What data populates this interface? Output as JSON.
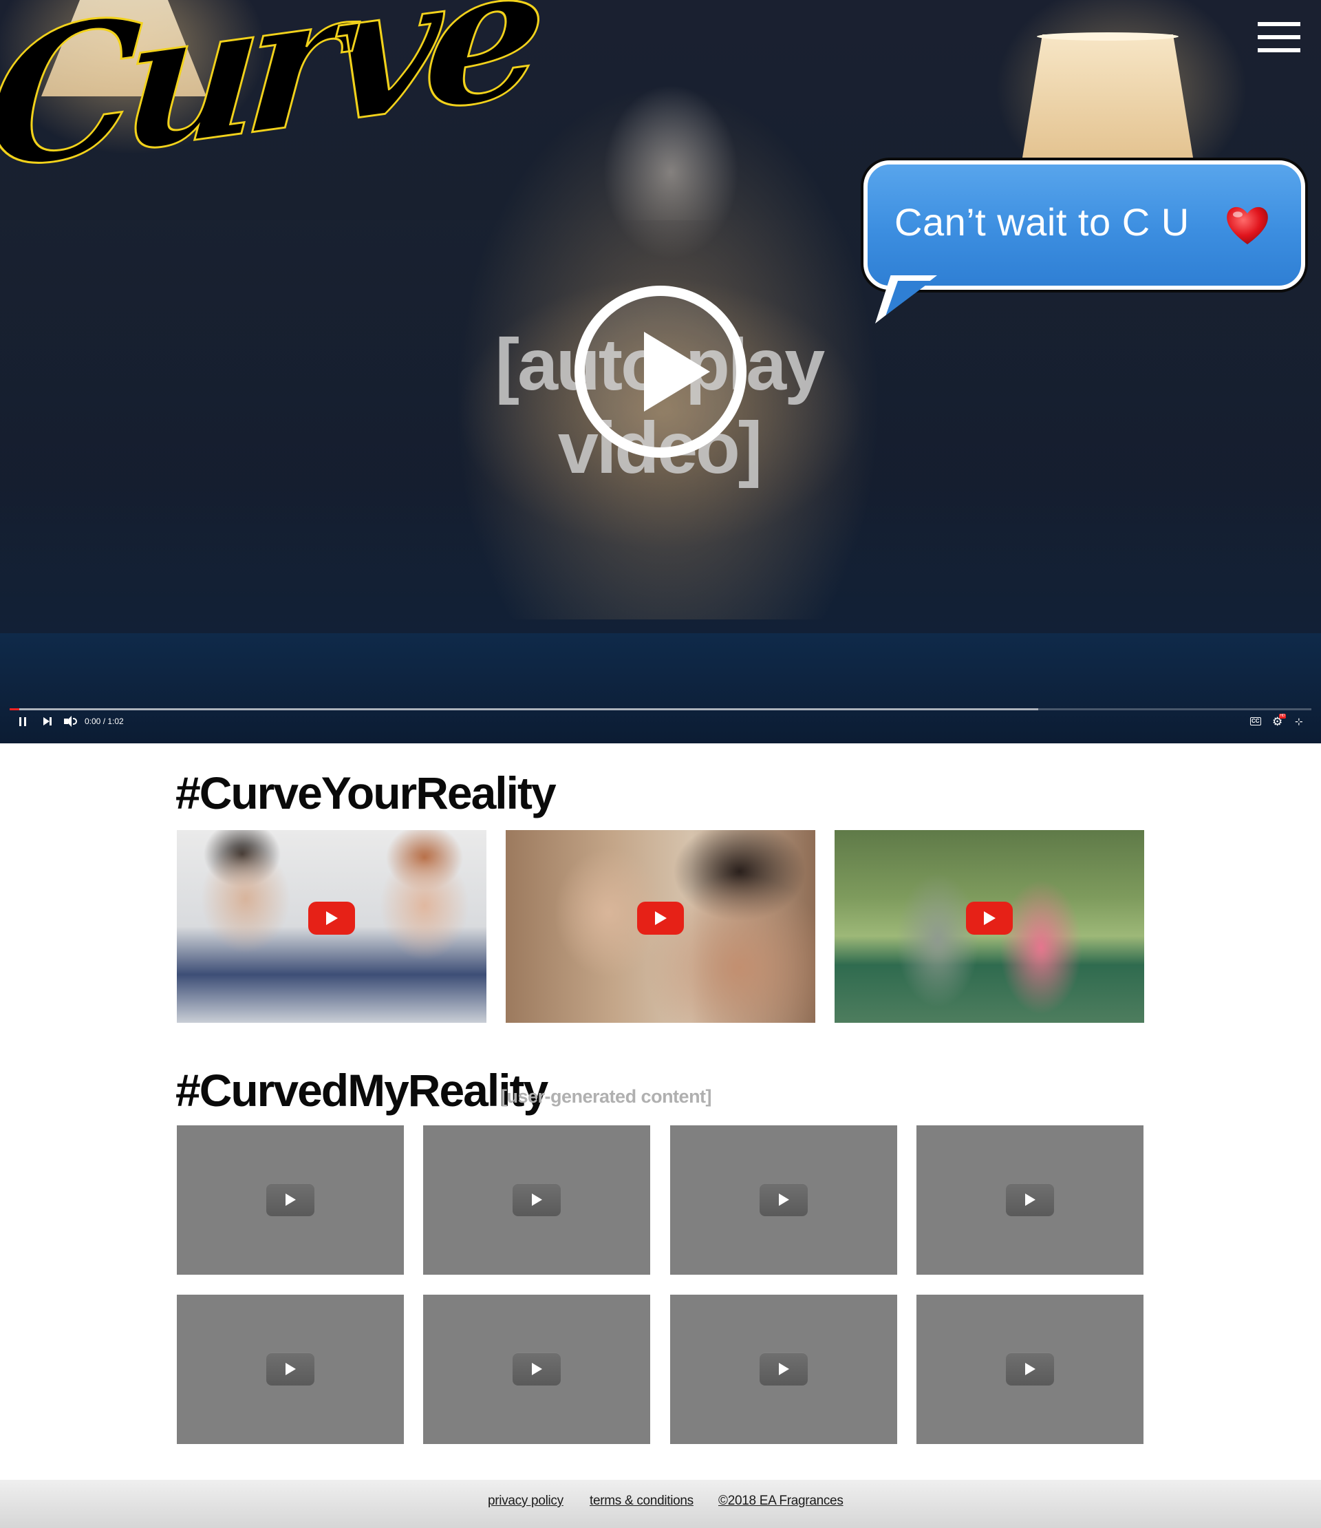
{
  "hero": {
    "logo_text": "Curve",
    "message_text": "Can’t wait to C U",
    "overlay_label": "[auto-play video]",
    "player": {
      "time_display": "0:00 / 1:02",
      "progress_fraction": 0.0,
      "buffered_fraction": 0.79
    },
    "icons": {
      "menu": "hamburger-menu-icon",
      "heart": "heart-icon",
      "play": "play-icon",
      "pause": "pause-icon",
      "next": "next-icon",
      "volume": "volume-icon",
      "captions": "cc-icon",
      "settings": "settings-icon",
      "fullscreen": "fullscreen-exit-icon"
    }
  },
  "curve_your_reality": {
    "title": "#CurveYourReality",
    "videos": [
      {
        "icon": "youtube-play-icon"
      },
      {
        "icon": "youtube-play-icon"
      },
      {
        "icon": "youtube-play-icon"
      }
    ]
  },
  "curved_my_reality": {
    "title": "#CurvedMyReality",
    "subtitle": "[user-generated content]",
    "videos": [
      {
        "icon": "play-icon"
      },
      {
        "icon": "play-icon"
      },
      {
        "icon": "play-icon"
      },
      {
        "icon": "play-icon"
      },
      {
        "icon": "play-icon"
      },
      {
        "icon": "play-icon"
      },
      {
        "icon": "play-icon"
      },
      {
        "icon": "play-icon"
      }
    ]
  },
  "footer": {
    "privacy": "privacy policy",
    "terms": "terms & conditions",
    "copyright": "©2018 EA Fragrances"
  },
  "colors": {
    "logo_outline": "#f2d21b",
    "bubble_blue": "#3c8ee0",
    "youtube_red": "#e62117",
    "placeholder_gray": "#808080"
  }
}
